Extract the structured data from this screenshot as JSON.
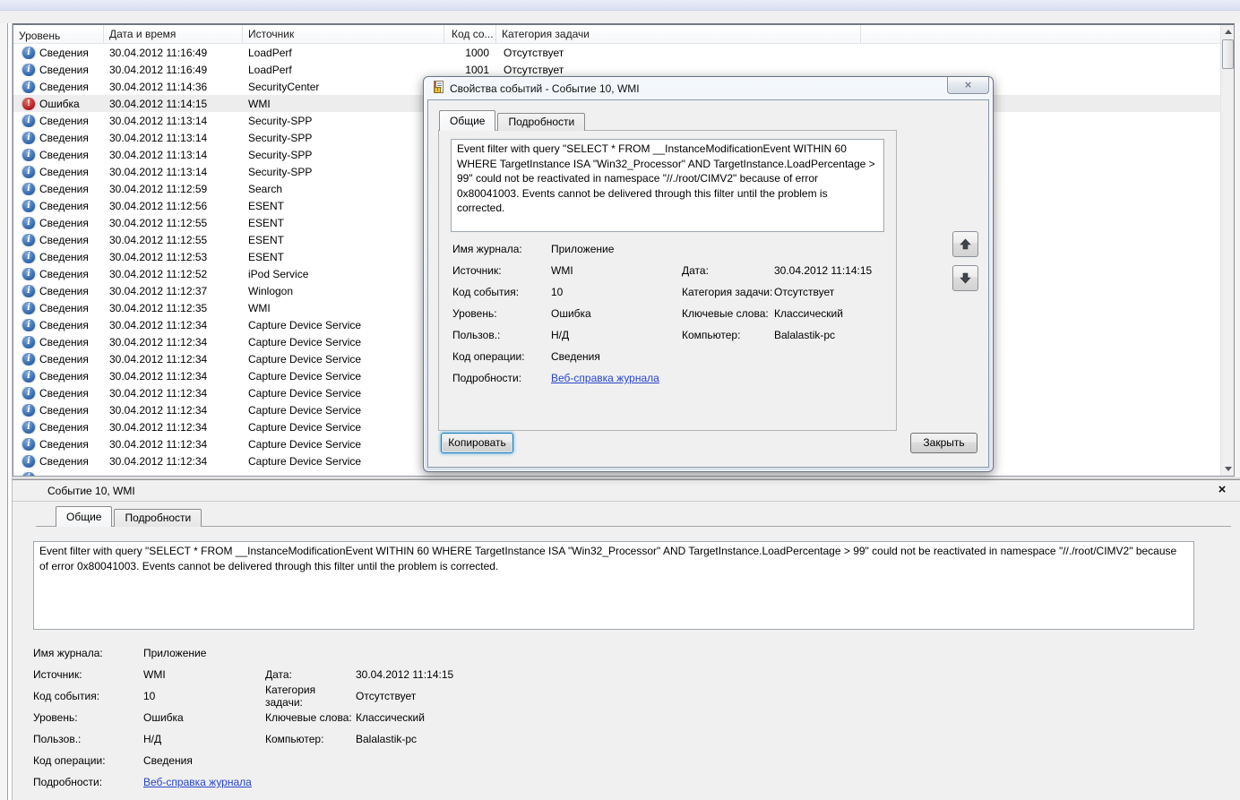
{
  "glyphs": {
    "close": "×",
    "info": "i",
    "error": "!"
  },
  "colors": {
    "info_icon_blue": "#2b62a9",
    "error_icon_red": "#b31418",
    "link_blue": "#2645cf",
    "selection_gray": "#ededed",
    "dialog_chrome": "#d9e2ee"
  },
  "table": {
    "columns": [
      "Уровень",
      "Дата и время",
      "Источник",
      "Код со...",
      "Категория задачи"
    ],
    "rows": [
      {
        "icon": "info",
        "level": "Сведения",
        "datetime": "30.04.2012 11:16:49",
        "source": "LoadPerf",
        "code": "1000",
        "category": "Отсутствует",
        "selected": false
      },
      {
        "icon": "info",
        "level": "Сведения",
        "datetime": "30.04.2012 11:16:49",
        "source": "LoadPerf",
        "code": "1001",
        "category": "Отсутствует",
        "selected": false
      },
      {
        "icon": "info",
        "level": "Сведения",
        "datetime": "30.04.2012 11:14:36",
        "source": "SecurityCenter",
        "code": "",
        "category": "",
        "selected": false
      },
      {
        "icon": "error",
        "level": "Ошибка",
        "datetime": "30.04.2012 11:14:15",
        "source": "WMI",
        "code": "",
        "category": "",
        "selected": true
      },
      {
        "icon": "info",
        "level": "Сведения",
        "datetime": "30.04.2012 11:13:14",
        "source": "Security-SPP",
        "code": "",
        "category": "",
        "selected": false
      },
      {
        "icon": "info",
        "level": "Сведения",
        "datetime": "30.04.2012 11:13:14",
        "source": "Security-SPP",
        "code": "",
        "category": "",
        "selected": false
      },
      {
        "icon": "info",
        "level": "Сведения",
        "datetime": "30.04.2012 11:13:14",
        "source": "Security-SPP",
        "code": "",
        "category": "",
        "selected": false
      },
      {
        "icon": "info",
        "level": "Сведения",
        "datetime": "30.04.2012 11:13:14",
        "source": "Security-SPP",
        "code": "",
        "category": "",
        "selected": false
      },
      {
        "icon": "info",
        "level": "Сведения",
        "datetime": "30.04.2012 11:12:59",
        "source": "Search",
        "code": "",
        "category": "",
        "selected": false
      },
      {
        "icon": "info",
        "level": "Сведения",
        "datetime": "30.04.2012 11:12:56",
        "source": "ESENT",
        "code": "",
        "category": "",
        "selected": false
      },
      {
        "icon": "info",
        "level": "Сведения",
        "datetime": "30.04.2012 11:12:55",
        "source": "ESENT",
        "code": "",
        "category": "",
        "selected": false
      },
      {
        "icon": "info",
        "level": "Сведения",
        "datetime": "30.04.2012 11:12:55",
        "source": "ESENT",
        "code": "",
        "category": "",
        "selected": false
      },
      {
        "icon": "info",
        "level": "Сведения",
        "datetime": "30.04.2012 11:12:53",
        "source": "ESENT",
        "code": "",
        "category": "",
        "selected": false
      },
      {
        "icon": "info",
        "level": "Сведения",
        "datetime": "30.04.2012 11:12:52",
        "source": "iPod Service",
        "code": "",
        "category": "",
        "selected": false
      },
      {
        "icon": "info",
        "level": "Сведения",
        "datetime": "30.04.2012 11:12:37",
        "source": "Winlogon",
        "code": "",
        "category": "",
        "selected": false
      },
      {
        "icon": "info",
        "level": "Сведения",
        "datetime": "30.04.2012 11:12:35",
        "source": "WMI",
        "code": "",
        "category": "",
        "selected": false
      },
      {
        "icon": "info",
        "level": "Сведения",
        "datetime": "30.04.2012 11:12:34",
        "source": "Capture Device Service",
        "code": "",
        "category": "",
        "selected": false
      },
      {
        "icon": "info",
        "level": "Сведения",
        "datetime": "30.04.2012 11:12:34",
        "source": "Capture Device Service",
        "code": "",
        "category": "",
        "selected": false
      },
      {
        "icon": "info",
        "level": "Сведения",
        "datetime": "30.04.2012 11:12:34",
        "source": "Capture Device Service",
        "code": "",
        "category": "",
        "selected": false
      },
      {
        "icon": "info",
        "level": "Сведения",
        "datetime": "30.04.2012 11:12:34",
        "source": "Capture Device Service",
        "code": "",
        "category": "",
        "selected": false
      },
      {
        "icon": "info",
        "level": "Сведения",
        "datetime": "30.04.2012 11:12:34",
        "source": "Capture Device Service",
        "code": "",
        "category": "",
        "selected": false
      },
      {
        "icon": "info",
        "level": "Сведения",
        "datetime": "30.04.2012 11:12:34",
        "source": "Capture Device Service",
        "code": "",
        "category": "",
        "selected": false
      },
      {
        "icon": "info",
        "level": "Сведения",
        "datetime": "30.04.2012 11:12:34",
        "source": "Capture Device Service",
        "code": "",
        "category": "",
        "selected": false
      },
      {
        "icon": "info",
        "level": "Сведения",
        "datetime": "30.04.2012 11:12:34",
        "source": "Capture Device Service",
        "code": "",
        "category": "",
        "selected": false
      },
      {
        "icon": "info",
        "level": "Сведения",
        "datetime": "30.04.2012 11:12:34",
        "source": "Capture Device Service",
        "code": "",
        "category": "",
        "selected": false
      },
      {
        "icon": "info",
        "level": "",
        "datetime": "",
        "source": "",
        "code": "",
        "category": "",
        "selected": false
      }
    ]
  },
  "event": {
    "title": "Событие 10, WMI",
    "tabs": {
      "general": "Общие",
      "details": "Подробности"
    },
    "message": "Event filter with query \"SELECT * FROM __InstanceModificationEvent WITHIN 60 WHERE TargetInstance ISA \"Win32_Processor\" AND TargetInstance.LoadPercentage > 99\" could not be reactivated in namespace \"//./root/CIMV2\" because of error 0x80041003. Events cannot be delivered through this filter until the problem is corrected.",
    "fields": {
      "log_name_label": "Имя журнала:",
      "log_name": "Приложение",
      "source_label": "Источник:",
      "source": "WMI",
      "event_id_label": "Код события:",
      "event_id": "10",
      "level_label": "Уровень:",
      "level": "Ошибка",
      "user_label": "Пользов.:",
      "user": "Н/Д",
      "opcode_label": "Код операции:",
      "opcode": "Сведения",
      "more_info_label": "Подробности:",
      "more_info_link": "Веб-справка журнала",
      "date_label": "Дата:",
      "date": "30.04.2012 11:14:15",
      "task_category_label": "Категория задачи:",
      "task_category": "Отсутствует",
      "keywords_label": "Ключевые слова:",
      "keywords": "Классический",
      "computer_label": "Компьютер:",
      "computer": "Balalastik-pc"
    }
  },
  "dialog": {
    "title": "Свойства событий - Событие 10, WMI",
    "copy_button": "Копировать",
    "close_button": "Закрыть"
  }
}
